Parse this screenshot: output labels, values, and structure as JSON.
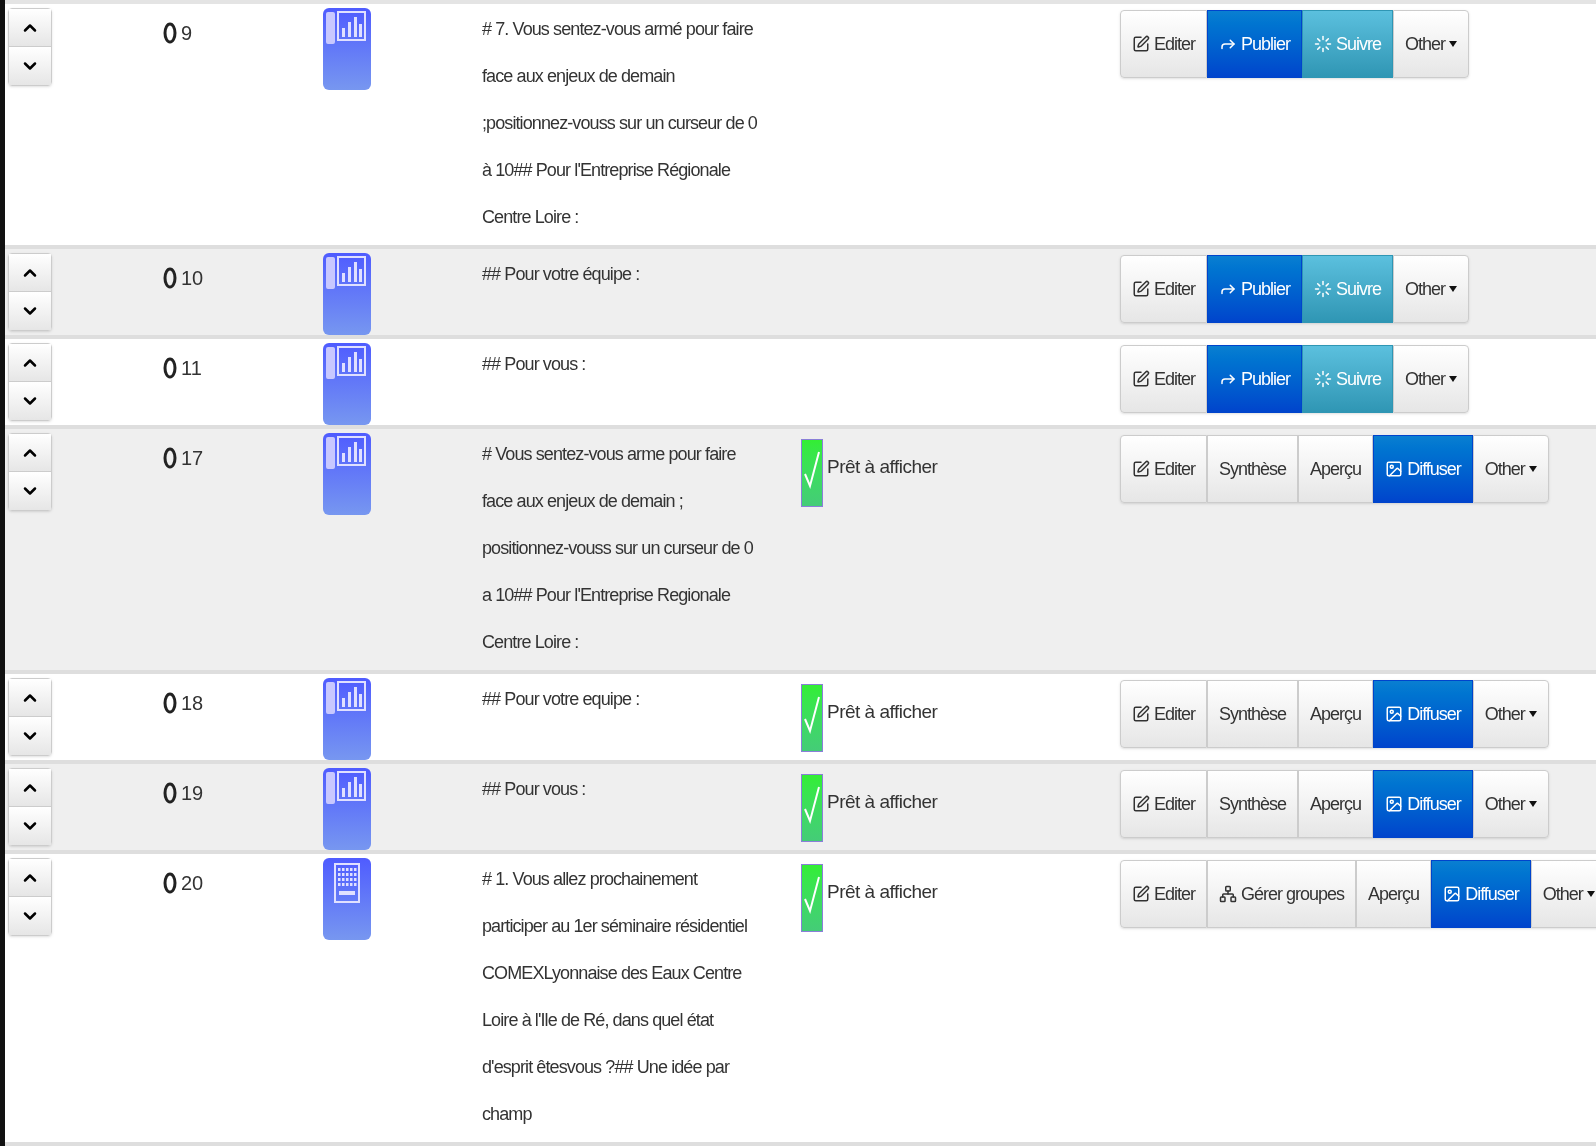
{
  "rows": [
    {
      "number": "9",
      "kind": "chart",
      "text": "# 7. Vous sentez-vous armé pour faire face aux enjeux de demain ;positionnez-vouss sur un curseur de 0 à 10## Pour l'Entreprise Régionale Centre Loire :",
      "buttons": [
        {
          "label": "Editer",
          "kind": "edit"
        },
        {
          "label": "Publier",
          "kind": "publish"
        },
        {
          "label": "Suivre",
          "kind": "follow"
        },
        {
          "label": "Other",
          "kind": "menu"
        }
      ]
    },
    {
      "number": "10",
      "kind": "chart",
      "text": "## Pour votre équipe :",
      "buttons": [
        {
          "label": "Editer",
          "kind": "edit"
        },
        {
          "label": "Publier",
          "kind": "publish"
        },
        {
          "label": "Suivre",
          "kind": "follow"
        },
        {
          "label": "Other",
          "kind": "menu"
        }
      ]
    },
    {
      "number": "11",
      "kind": "chart",
      "text": "## Pour vous :",
      "buttons": [
        {
          "label": "Editer",
          "kind": "edit"
        },
        {
          "label": "Publier",
          "kind": "publish"
        },
        {
          "label": "Suivre",
          "kind": "follow"
        },
        {
          "label": "Other",
          "kind": "menu"
        }
      ]
    },
    {
      "number": "17",
      "kind": "chart",
      "text": "# Vous sentez-vous arme pour faire face aux enjeux de demain ; positionnez-vouss sur un curseur de 0 a 10## Pour l'Entreprise Regionale Centre Loire :",
      "status": {
        "label": "Prêt à afficher",
        "checked": true
      },
      "buttons": [
        {
          "label": "Editer",
          "kind": "edit"
        },
        {
          "label": "Synthèse",
          "kind": "plain"
        },
        {
          "label": "Aperçu",
          "kind": "plain"
        },
        {
          "label": "Diffuser",
          "kind": "broadcast"
        },
        {
          "label": "Other",
          "kind": "menu"
        }
      ]
    },
    {
      "number": "18",
      "kind": "chart",
      "text": "## Pour votre equipe :",
      "status": {
        "label": "Prêt à afficher",
        "checked": true
      },
      "buttons": [
        {
          "label": "Editer",
          "kind": "edit"
        },
        {
          "label": "Synthèse",
          "kind": "plain"
        },
        {
          "label": "Aperçu",
          "kind": "plain"
        },
        {
          "label": "Diffuser",
          "kind": "broadcast"
        },
        {
          "label": "Other",
          "kind": "menu"
        }
      ]
    },
    {
      "number": "19",
      "kind": "chart",
      "text": "## Pour vous :",
      "status": {
        "label": "Prêt à afficher",
        "checked": true
      },
      "buttons": [
        {
          "label": "Editer",
          "kind": "edit"
        },
        {
          "label": "Synthèse",
          "kind": "plain"
        },
        {
          "label": "Aperçu",
          "kind": "plain"
        },
        {
          "label": "Diffuser",
          "kind": "broadcast"
        },
        {
          "label": "Other",
          "kind": "menu"
        }
      ]
    },
    {
      "number": "20",
      "kind": "keyboard",
      "text": "# 1. Vous allez prochainement participer au 1er séminaire résidentiel COMEXLyonnaise des Eaux Centre Loire à l'Ile de Ré, dans quel état d'esprit êtesvous ?## Une idée par champ",
      "status": {
        "label": "Prêt à afficher",
        "checked": true
      },
      "buttons": [
        {
          "label": "Editer",
          "kind": "edit"
        },
        {
          "label": "Gérer groupes",
          "kind": "groups"
        },
        {
          "label": "Aperçu",
          "kind": "plain"
        },
        {
          "label": "Diffuser",
          "kind": "broadcast"
        },
        {
          "label": "Other",
          "kind": "menu"
        }
      ]
    }
  ]
}
